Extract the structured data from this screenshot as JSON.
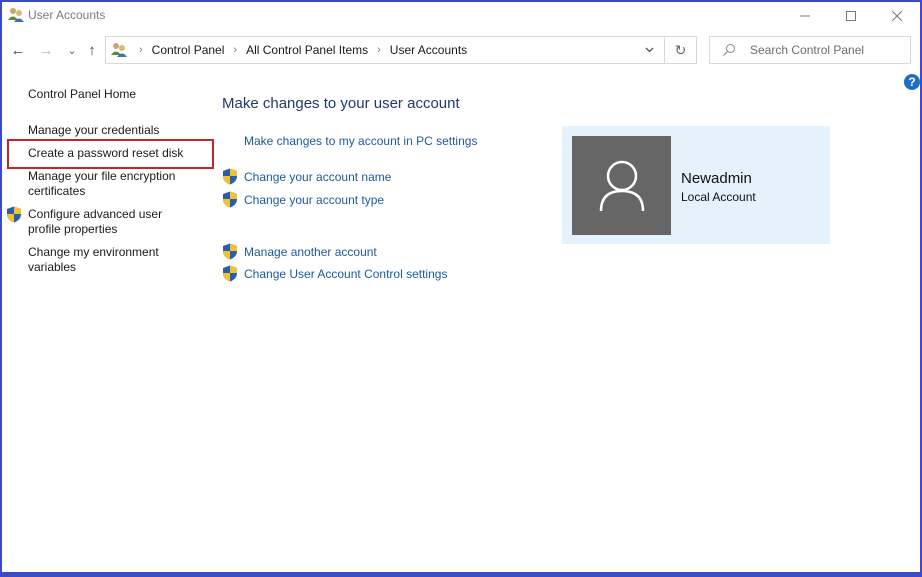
{
  "window": {
    "title": "User Accounts",
    "controls": {
      "minimize": "—",
      "maximize": "☐",
      "close": "✕"
    }
  },
  "nav": {
    "back": "←",
    "forward": "→",
    "recent": "⌄",
    "up": "↑",
    "breadcrumbs": [
      "Control Panel",
      "All Control Panel Items",
      "User Accounts"
    ],
    "separator": "›",
    "dropdown": "⌄",
    "refresh": "↻",
    "search_placeholder": "Search Control Panel",
    "help": "?"
  },
  "sidebar": {
    "home": "Control Panel Home",
    "items": [
      {
        "label": "Manage your credentials",
        "shield": false
      },
      {
        "label": "Create a password reset disk",
        "shield": false,
        "highlighted": true
      },
      {
        "label": "Manage your file encryption certificates",
        "line1": "Manage your file encryption",
        "line2": "certificates",
        "shield": false
      },
      {
        "label": "Configure advanced user profile properties",
        "line1": "Configure advanced user",
        "line2": "profile properties",
        "shield": true
      },
      {
        "label": "Change my environment variables",
        "line1": "Change my environment",
        "line2": "variables",
        "shield": false
      }
    ],
    "highlight_color": "#c8232c"
  },
  "main": {
    "heading": "Make changes to your user account",
    "links": [
      {
        "label": "Make changes to my account in PC settings",
        "shield": false
      },
      {
        "label": "Change your account name",
        "shield": true
      },
      {
        "label": "Change your account type",
        "shield": true
      },
      {
        "label": "Manage another account",
        "shield": true
      },
      {
        "label": "Change User Account Control settings",
        "shield": true
      }
    ],
    "link_color": "#1c5a9c"
  },
  "account": {
    "name": "Newadmin",
    "type": "Local Account",
    "card_color": "#e5f1fb",
    "avatar_color": "#666666"
  }
}
